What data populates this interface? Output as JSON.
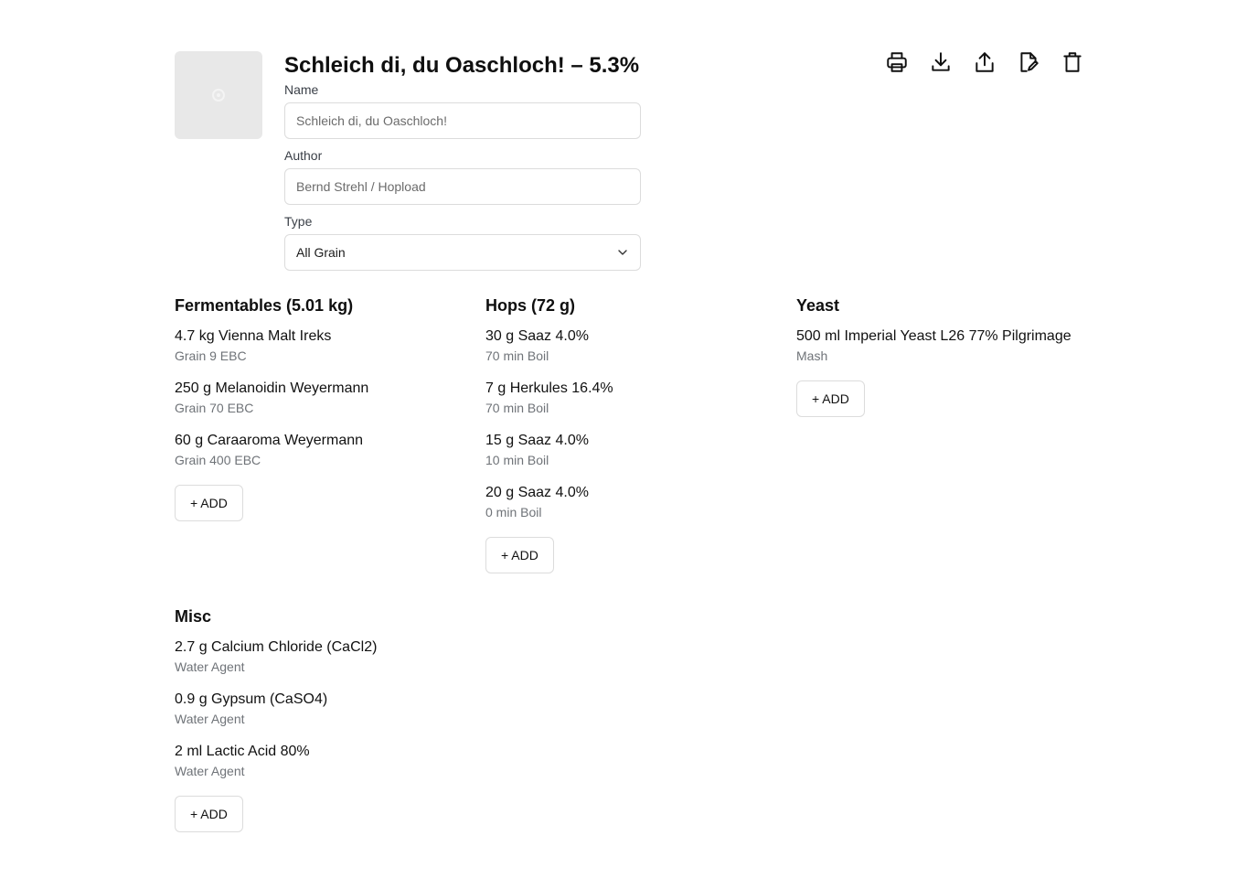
{
  "recipe": {
    "title": "Schleich di, du Oaschloch! – 5.3%",
    "name_label": "Name",
    "name_placeholder": "Schleich di, du Oaschloch!",
    "author_label": "Author",
    "author_placeholder": "Bernd Strehl / Hopload",
    "type_label": "Type",
    "type_value": "All Grain"
  },
  "toolbar": {
    "icons": [
      "printer-icon",
      "download-icon",
      "share-icon",
      "edit-file-icon",
      "trash-icon"
    ]
  },
  "fermentables": {
    "title": "Fermentables (5.01 kg)",
    "items": [
      {
        "main": "4.7 kg Vienna Malt Ireks",
        "sub": "Grain 9 EBC"
      },
      {
        "main": "250 g Melanoidin Weyermann",
        "sub": "Grain 70 EBC"
      },
      {
        "main": "60 g Caraaroma Weyermann",
        "sub": "Grain 400 EBC"
      }
    ],
    "add_label": "+ ADD"
  },
  "hops": {
    "title": "Hops (72 g)",
    "items": [
      {
        "main": "30 g Saaz 4.0%",
        "sub": "70 min Boil"
      },
      {
        "main": "7 g Herkules 16.4%",
        "sub": "70 min Boil"
      },
      {
        "main": "15 g Saaz 4.0%",
        "sub": "10 min Boil"
      },
      {
        "main": "20 g Saaz 4.0%",
        "sub": "0 min Boil"
      }
    ],
    "add_label": "+ ADD"
  },
  "yeast": {
    "title": "Yeast",
    "items": [
      {
        "main": "500 ml Imperial Yeast L26 77% Pilgrimage",
        "sub": "Mash"
      }
    ],
    "add_label": "+ ADD"
  },
  "misc": {
    "title": "Misc",
    "items": [
      {
        "main": "2.7 g Calcium Chloride (CaCl2)",
        "sub": "Water Agent"
      },
      {
        "main": "0.9 g Gypsum (CaSO4)",
        "sub": "Water Agent"
      },
      {
        "main": "2 ml Lactic Acid 80%",
        "sub": "Water Agent"
      }
    ],
    "add_label": "+ ADD"
  }
}
